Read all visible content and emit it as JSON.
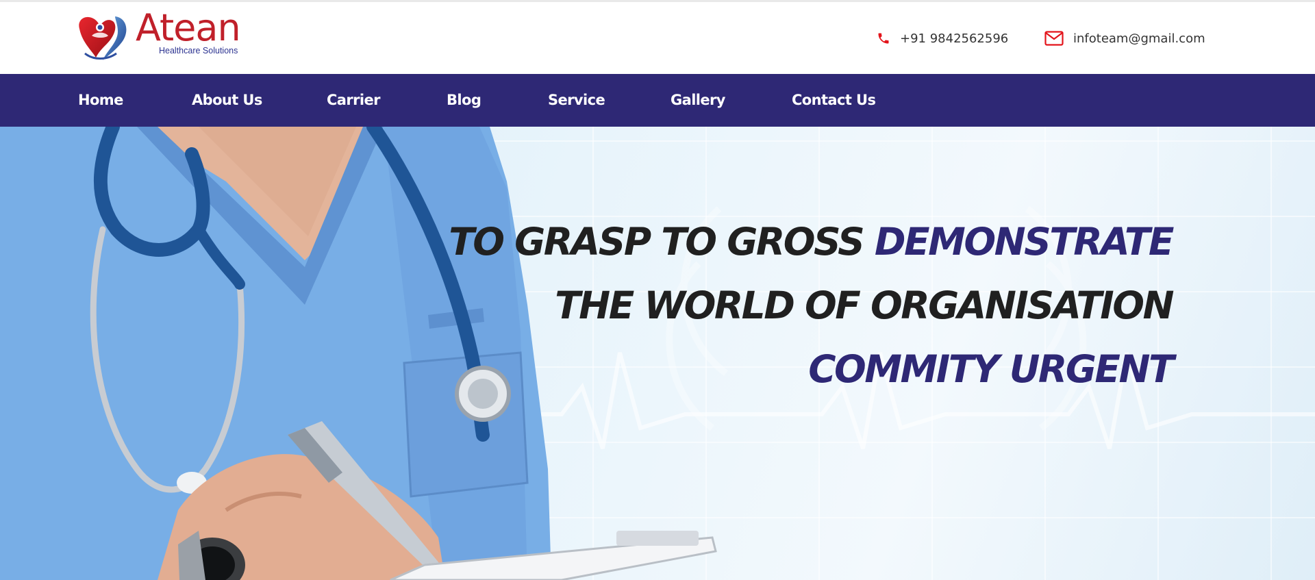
{
  "brand": {
    "name": "Atean",
    "tagline": "Healthcare Solutions",
    "colors": {
      "primary_red": "#c0202a",
      "navy": "#2e2875"
    }
  },
  "header": {
    "phone": {
      "icon": "phone-icon",
      "text": "+91 9842562596"
    },
    "email": {
      "icon": "envelope-icon",
      "text": "infoteam@gmail.com"
    }
  },
  "nav": {
    "items": [
      {
        "label": "Home"
      },
      {
        "label": "About Us"
      },
      {
        "label": "Carrier"
      },
      {
        "label": "Blog"
      },
      {
        "label": "Service"
      },
      {
        "label": "Gallery"
      },
      {
        "label": "Contact Us"
      }
    ]
  },
  "hero": {
    "line1_a": "TO GRASP TO GROSS ",
    "line1_b": "DEMONSTRATE",
    "line2": "THE WORLD OF ORGANISATION",
    "line3": "COMMITY URGENT"
  }
}
